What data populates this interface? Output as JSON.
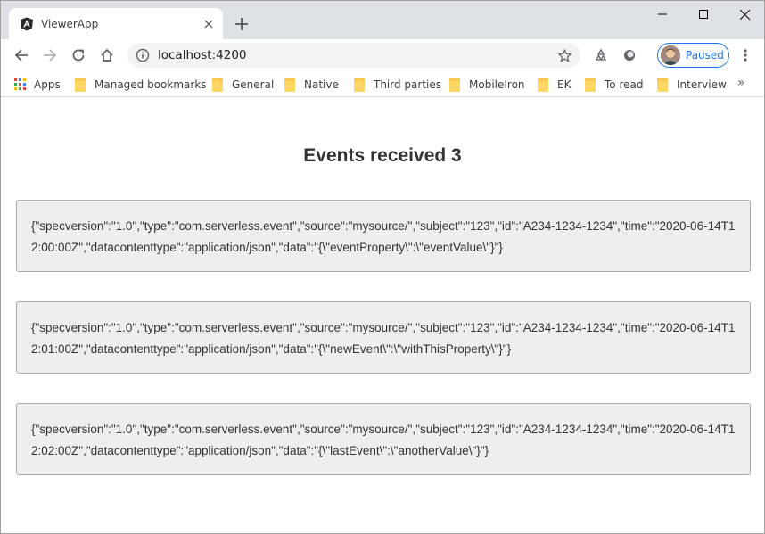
{
  "browser": {
    "tab_title": "ViewerApp",
    "url": "localhost:4200",
    "profile_label": "Paused",
    "bookmarks": [
      "Apps",
      "Managed bookmarks",
      "General",
      "Native",
      "Third parties",
      "MobileIron",
      "EK",
      "To read",
      "Interview"
    ],
    "overflow_label": "»"
  },
  "page": {
    "heading": "Events received 3",
    "events": [
      "{\"specversion\":\"1.0\",\"type\":\"com.serverless.event\",\"source\":\"mysource/\",\"subject\":\"123\",\"id\":\"A234-1234-1234\",\"time\":\"2020-06-14T12:00:00Z\",\"datacontenttype\":\"application/json\",\"data\":\"{\\\"eventProperty\\\":\\\"eventValue\\\"}\"}",
      "{\"specversion\":\"1.0\",\"type\":\"com.serverless.event\",\"source\":\"mysource/\",\"subject\":\"123\",\"id\":\"A234-1234-1234\",\"time\":\"2020-06-14T12:01:00Z\",\"datacontenttype\":\"application/json\",\"data\":\"{\\\"newEvent\\\":\\\"withThisProperty\\\"}\"}",
      "{\"specversion\":\"1.0\",\"type\":\"com.serverless.event\",\"source\":\"mysource/\",\"subject\":\"123\",\"id\":\"A234-1234-1234\",\"time\":\"2020-06-14T12:02:00Z\",\"datacontenttype\":\"application/json\",\"data\":\"{\\\"lastEvent\\\":\\\"anotherValue\\\"}\"}"
    ]
  },
  "colors": {
    "accent": "#1a73e8",
    "tabstrip": "#dee1e6",
    "event_background": "#eeeeee",
    "folder": "#fdd663"
  }
}
